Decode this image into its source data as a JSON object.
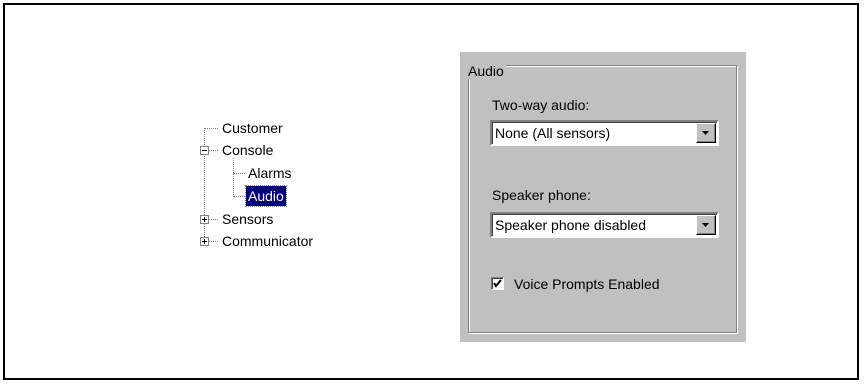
{
  "tree": {
    "items": [
      {
        "label": "Customer"
      },
      {
        "label": "Console",
        "expanded": true
      },
      {
        "label": "Alarms"
      },
      {
        "label": "Audio",
        "selected": true
      },
      {
        "label": "Sensors",
        "expanded": false
      },
      {
        "label": "Communicator",
        "expanded": false
      }
    ]
  },
  "audio_group": {
    "title": "Audio",
    "two_way_label": "Two-way audio:",
    "two_way_value": "None (All sensors)",
    "speaker_label": "Speaker phone:",
    "speaker_value": "Speaker phone disabled",
    "voice_prompts_label": "Voice Prompts Enabled",
    "voice_prompts_checked": true
  },
  "colors": {
    "panel_bg": "#c0c0c0",
    "selection_bg": "#000080"
  }
}
